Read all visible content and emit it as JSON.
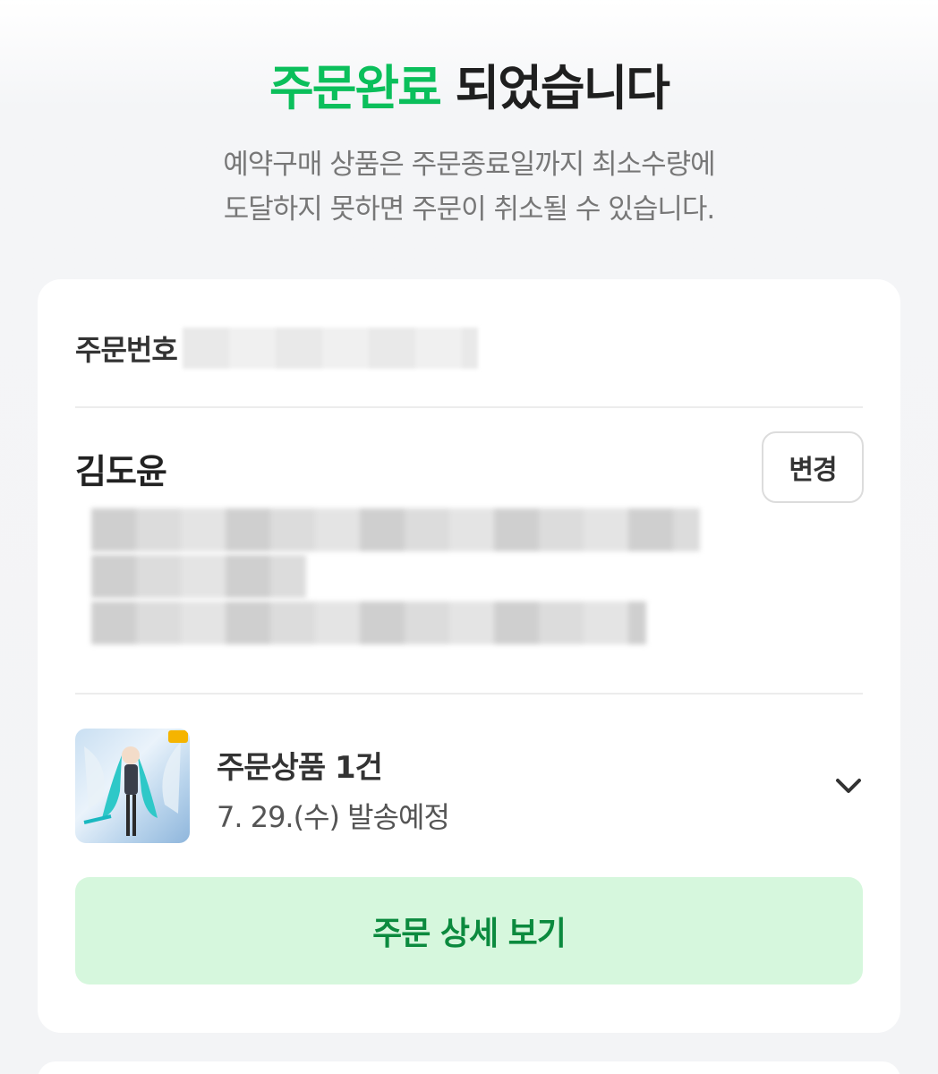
{
  "header": {
    "title_accent": "주문완료",
    "title_rest": " 되었습니다",
    "notice_line1": "예약구매 상품은 주문종료일까지 최소수량에",
    "notice_line2": "도달하지 못하면 주문이 취소될 수 있습니다."
  },
  "order": {
    "number_label": "주문번호"
  },
  "recipient": {
    "name": "김도윤",
    "change_label": "변경"
  },
  "product": {
    "summary": "주문상품 1건",
    "ship_date": "7. 29.(수) 발송예정",
    "expand_icon": "chevron-down-icon"
  },
  "actions": {
    "detail_label": "주문 상세 보기"
  },
  "colors": {
    "accent": "#0bbf5b",
    "button_bg": "#d6f7dd",
    "button_text": "#0b8a3e"
  }
}
